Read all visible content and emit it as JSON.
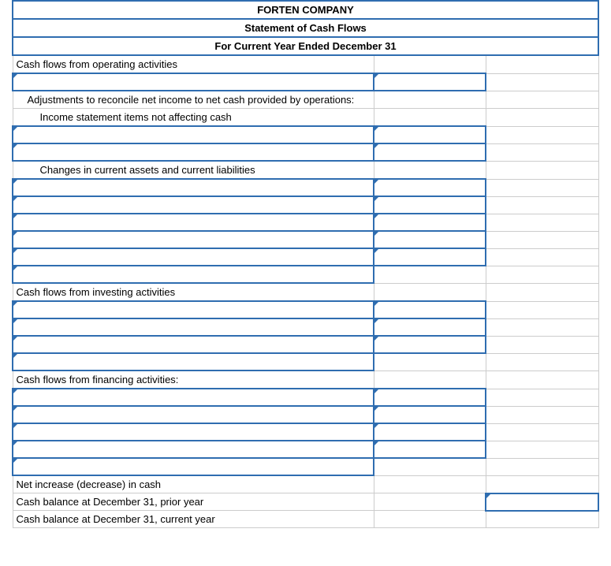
{
  "header": {
    "company": "FORTEN COMPANY",
    "title": "Statement of Cash Flows",
    "period": "For Current Year Ended December 31"
  },
  "labels": {
    "op": "Cash flows from operating activities",
    "adj": "Adjustments to reconcile net income to net cash provided by operations:",
    "nocash": "Income statement items not affecting cash",
    "changes": "Changes in current assets and current liabilities",
    "inv": "Cash flows from investing activities",
    "fin": "Cash flows from financing activities:",
    "net": "Net increase (decrease) in cash",
    "prior": "Cash balance at December 31, prior year",
    "current": "Cash balance at December 31, current year"
  }
}
